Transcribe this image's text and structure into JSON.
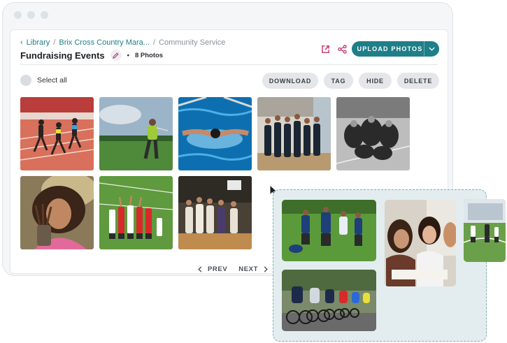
{
  "breadcrumb": {
    "items": [
      "Library",
      "Brix Cross Country Mara...",
      "Community Service"
    ]
  },
  "header": {
    "title": "Fundraising Events",
    "photo_count": "8 Photos",
    "upload_label": "UPLOAD PHOTOS"
  },
  "toolbar": {
    "select_all": "Select all",
    "download": "DOWNLOAD",
    "tag": "TAG",
    "hide": "HIDE",
    "delete": "DELETE"
  },
  "pagination": {
    "prev": "PREV",
    "next": "NEXT"
  },
  "icons": {
    "back": "chevron-left-icon",
    "edit": "pencil-icon",
    "open": "external-link-icon",
    "share": "share-icon",
    "dropdown": "chevron-down-icon",
    "pointer": "mouse-pointer-icon"
  },
  "colors": {
    "accent": "#1f7f88",
    "edit_accent": "#c5306b",
    "drop_zone_bg": "#e3edef",
    "drop_zone_border": "#7fb0b5"
  },
  "photos": [
    {
      "subject": "track-race-photo"
    },
    {
      "subject": "golf-swing-photo"
    },
    {
      "subject": "swimmer-butterfly-photo"
    },
    {
      "subject": "basketball-team-huddle-photo"
    },
    {
      "subject": "team-huddle-bw-photo"
    },
    {
      "subject": "girl-paintbrushes-photo"
    },
    {
      "subject": "soccer-team-cheer-photo"
    },
    {
      "subject": "gym-group-photo"
    }
  ],
  "dragged_photos": [
    {
      "subject": "rugby-match-photo"
    },
    {
      "subject": "students-studying-photo"
    },
    {
      "subject": "cycling-race-photo"
    },
    {
      "subject": "youth-soccer-photo"
    }
  ]
}
